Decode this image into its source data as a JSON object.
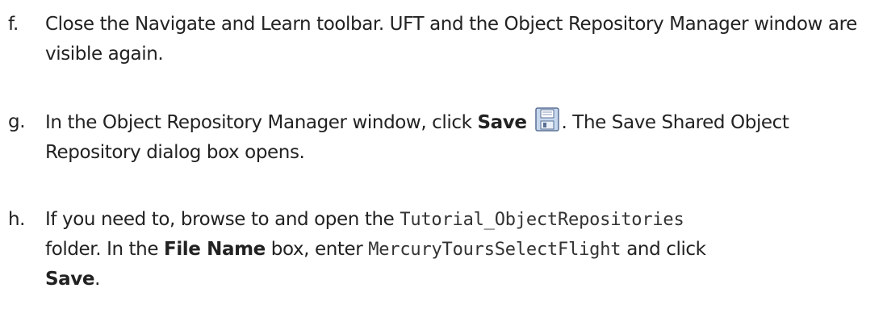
{
  "steps": [
    {
      "marker": "f.",
      "text": "Close the Navigate and Learn toolbar. UFT and the Object Repository Manager window are visible again."
    },
    {
      "marker": "g.",
      "text_before": "In the Object Repository Manager window, click ",
      "bold": "Save",
      "icon": "save-icon",
      "text_after": ". The Save Shared Object Repository dialog box opens."
    },
    {
      "marker": "h.",
      "text_1": "If you need to, browse to and open the ",
      "code_1": "Tutorial_ObjectRepositories",
      "text_2": " folder. In the ",
      "bold_1": "File Name",
      "text_3": " box, enter ",
      "code_2": "MercuryToursSelectFlight",
      "text_4": " and click ",
      "bold_2": "Save",
      "text_5": "."
    }
  ],
  "colors": {
    "text": "#222222",
    "icon_fill": "#c6d8ee",
    "icon_stroke": "#5a6f94"
  }
}
